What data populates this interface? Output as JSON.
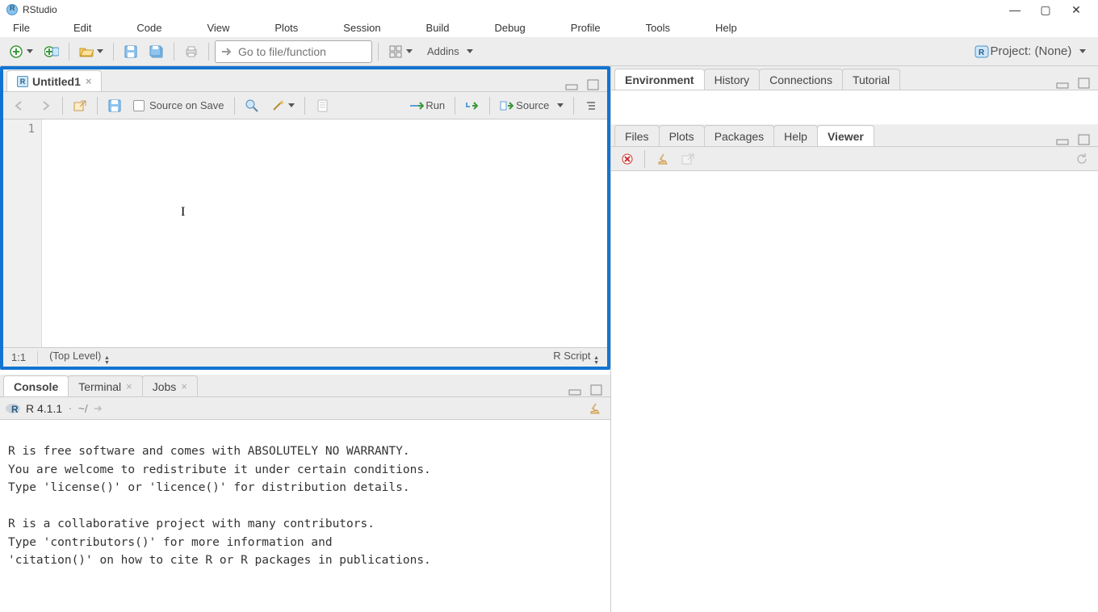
{
  "app": {
    "title": "RStudio"
  },
  "menu": [
    "File",
    "Edit",
    "Code",
    "View",
    "Plots",
    "Session",
    "Build",
    "Debug",
    "Profile",
    "Tools",
    "Help"
  ],
  "toolbar": {
    "goto_placeholder": "Go to file/function",
    "addins_label": "Addins",
    "project_label": "Project: (None)"
  },
  "source": {
    "tab_label": "Untitled1",
    "source_on_save": "Source on Save",
    "run_label": "Run",
    "source_label": "Source",
    "line_number": "1",
    "status_pos": "1:1",
    "scope_label": "(Top Level)",
    "filetype_label": "R Script"
  },
  "console": {
    "tabs": [
      "Console",
      "Terminal",
      "Jobs"
    ],
    "version": "R 4.1.1",
    "wd": "~/",
    "text": "\nR is free software and comes with ABSOLUTELY NO WARRANTY.\nYou are welcome to redistribute it under certain conditions.\nType 'license()' or 'licence()' for distribution details.\n\nR is a collaborative project with many contributors.\nType 'contributors()' for more information and\n'citation()' on how to cite R or R packages in publications."
  },
  "env": {
    "tabs": [
      "Environment",
      "History",
      "Connections",
      "Tutorial"
    ]
  },
  "fileviewer": {
    "tabs": [
      "Files",
      "Plots",
      "Packages",
      "Help",
      "Viewer"
    ],
    "active": 4
  }
}
